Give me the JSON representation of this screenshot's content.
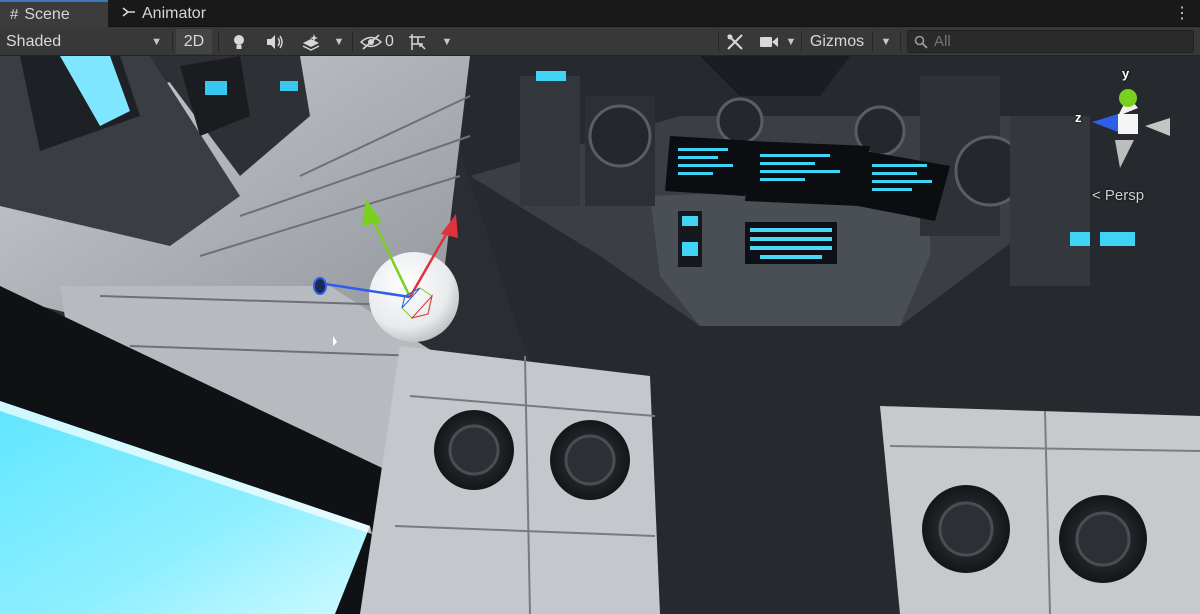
{
  "tabs": [
    {
      "label": "Scene",
      "icon": "grid-icon"
    },
    {
      "label": "Animator",
      "icon": "animator-icon"
    }
  ],
  "toolbar": {
    "shading_mode": "Shaded",
    "mode_2d": "2D",
    "hidden_count": "0",
    "gizmos": "Gizmos",
    "search_placeholder": "All"
  },
  "orientation_gizmo": {
    "y_label": "y",
    "z_label": "z",
    "projection": "< Persp",
    "colors": {
      "x": "#e0323b",
      "y": "#7ad020",
      "z": "#2f5ee8"
    }
  },
  "colors": {
    "accent": "#3a79bb",
    "screen_glow": "#4fdcff"
  }
}
